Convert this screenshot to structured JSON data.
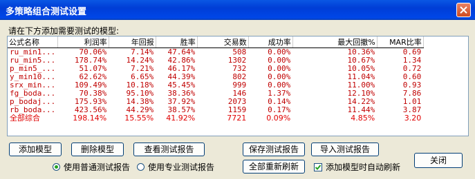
{
  "window": {
    "title": "多策略组合测试设置"
  },
  "prompt": "请在下方添加需要测试的模型:",
  "table": {
    "headers": [
      "公式名称",
      "利润率",
      "年回报",
      "胜率",
      "交易数",
      "成功率",
      "最大回撤%",
      "MAR比率"
    ],
    "rows": [
      [
        "ru_min1...",
        "70.06%",
        "7.14%",
        "47.64%",
        "508",
        "0.00%",
        "10.36%",
        "0.69"
      ],
      [
        "ru_min5...",
        "178.74%",
        "14.24%",
        "42.86%",
        "1302",
        "0.00%",
        "10.67%",
        "1.34"
      ],
      [
        "p_min5_...",
        "51.07%",
        "7.21%",
        "46.17%",
        "732",
        "0.00%",
        "10.05%",
        "0.72"
      ],
      [
        "y_min10...",
        "62.62%",
        "6.65%",
        "44.39%",
        "802",
        "0.00%",
        "11.04%",
        "0.60"
      ],
      [
        "srx_min...",
        "109.49%",
        "10.18%",
        "45.45%",
        "999",
        "0.00%",
        "11.00%",
        "0.93"
      ],
      [
        "fg_boda...",
        "70.38%",
        "95.10%",
        "38.36%",
        "146",
        "1.37%",
        "12.10%",
        "7.86"
      ],
      [
        "p_bodaj...",
        "175.93%",
        "14.38%",
        "37.92%",
        "2073",
        "0.14%",
        "14.22%",
        "1.01"
      ],
      [
        "rb_boda...",
        "423.56%",
        "44.29%",
        "38.57%",
        "1159",
        "0.17%",
        "11.44%",
        "3.87"
      ]
    ],
    "total": [
      "全部综合",
      "198.14%",
      "15.55%",
      "41.92%",
      "7721",
      "0.09%",
      "4.85%",
      "3.20"
    ]
  },
  "buttons": {
    "add_model": "添加模型",
    "delete_model": "删除模型",
    "view_report": "查看测试报告",
    "save_report": "保存测试报告",
    "import_report": "导入测试报告",
    "refresh_all": "全部重新刷新",
    "close": "关闭"
  },
  "options": {
    "normal_report": "使用普通测试报告",
    "pro_report": "使用专业测试报告",
    "auto_refresh": "添加模型时自动刷新"
  }
}
